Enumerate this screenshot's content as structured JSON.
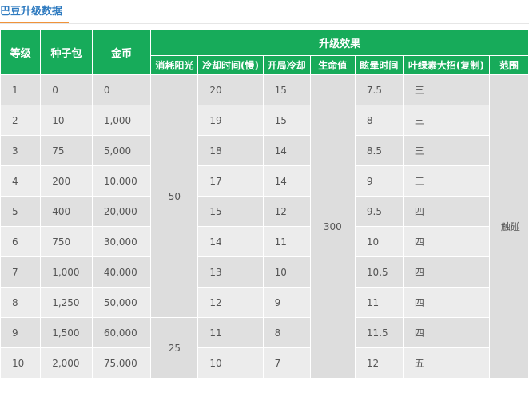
{
  "page": {
    "title": "巴豆升级数据"
  },
  "table": {
    "headers": {
      "level": "等级",
      "seed_packs": "种子包",
      "coins": "金币",
      "effect_group": "升级效果",
      "sun_cost": "消耗阳光",
      "cooldown": "冷却时间(慢)",
      "start_cooldown": "开局冷却",
      "health": "生命值",
      "stun_time": "眩晕时间",
      "chlorophyll": "叶绿素大招(复制)",
      "range": "范围"
    },
    "rows": [
      {
        "level": "1",
        "seed": "0",
        "coins": "0",
        "cooldown": "20",
        "start": "15",
        "stun": "7.5",
        "chloro": "三"
      },
      {
        "level": "2",
        "seed": "10",
        "coins": "1,000",
        "cooldown": "19",
        "start": "15",
        "stun": "8",
        "chloro": "三"
      },
      {
        "level": "3",
        "seed": "75",
        "coins": "5,000",
        "cooldown": "18",
        "start": "14",
        "stun": "8.5",
        "chloro": "三"
      },
      {
        "level": "4",
        "seed": "200",
        "coins": "10,000",
        "cooldown": "17",
        "start": "14",
        "stun": "9",
        "chloro": "三"
      },
      {
        "level": "5",
        "seed": "400",
        "coins": "20,000",
        "cooldown": "15",
        "start": "12",
        "stun": "9.5",
        "chloro": "四"
      },
      {
        "level": "6",
        "seed": "750",
        "coins": "30,000",
        "cooldown": "14",
        "start": "11",
        "stun": "10",
        "chloro": "四"
      },
      {
        "level": "7",
        "seed": "1,000",
        "coins": "40,000",
        "cooldown": "13",
        "start": "10",
        "stun": "10.5",
        "chloro": "四"
      },
      {
        "level": "8",
        "seed": "1,250",
        "coins": "50,000",
        "cooldown": "12",
        "start": "9",
        "stun": "11",
        "chloro": "四"
      },
      {
        "level": "9",
        "seed": "1,500",
        "coins": "60,000",
        "cooldown": "11",
        "start": "8",
        "stun": "11.5",
        "chloro": "四"
      },
      {
        "level": "10",
        "seed": "2,000",
        "coins": "75,000",
        "cooldown": "10",
        "start": "7",
        "stun": "12",
        "chloro": "五"
      }
    ],
    "merged": {
      "sun_cost_1_8": "50",
      "sun_cost_9_10": "25",
      "health_all": "300",
      "range_all": "触碰"
    }
  },
  "colors": {
    "header_green": "#17ab5a",
    "title_blue": "#2f7bc0",
    "accent_orange": "#f0933a"
  }
}
